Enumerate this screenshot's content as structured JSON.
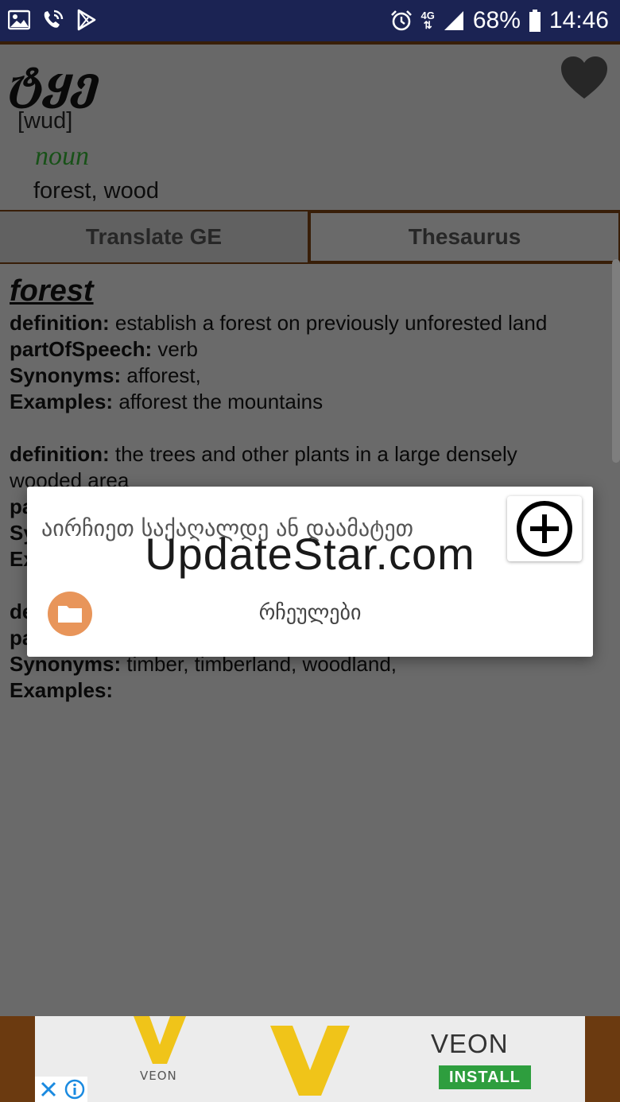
{
  "status_bar": {
    "battery": "68%",
    "time": "14:46",
    "network": "4G"
  },
  "word": {
    "title": "ტყე",
    "transcription": "[wud]",
    "part_of_speech": "noun",
    "translation": "forest, wood"
  },
  "tabs": [
    {
      "label": "Translate GE",
      "active": false
    },
    {
      "label": "Thesaurus",
      "active": true
    }
  ],
  "thesaurus": {
    "entry": "forest",
    "labels": {
      "definition": "definition:",
      "pos": "partOfSpeech:",
      "synonyms": "Synonyms:",
      "examples": "Examples:"
    },
    "senses": [
      {
        "definition": "establish a forest on previously unforested land",
        "pos": "verb",
        "synonyms": "afforest,",
        "examples": "afforest the mountains"
      },
      {
        "definition": "the trees and other plants in a large densely",
        "definition_cont": "wooded area"
      },
      {
        "synonyms": "timber, timberland, woodland,",
        "examples": ""
      }
    ]
  },
  "dialog": {
    "title": "აირჩიეთ საქაღალდე ან დაამატეთ",
    "folder_label": "რჩეულები"
  },
  "watermark": "UpdateStar.com",
  "ad": {
    "brand_small": "VEON",
    "brand": "VEON",
    "install": "INSTALL"
  },
  "colors": {
    "status_bar": "#1b2353",
    "accent_brown": "#6b3a10",
    "pos_green": "#2f9a2f",
    "folder_orange": "#e8955a",
    "install_green": "#2e9e3e",
    "veon_yellow": "#f0c419"
  }
}
